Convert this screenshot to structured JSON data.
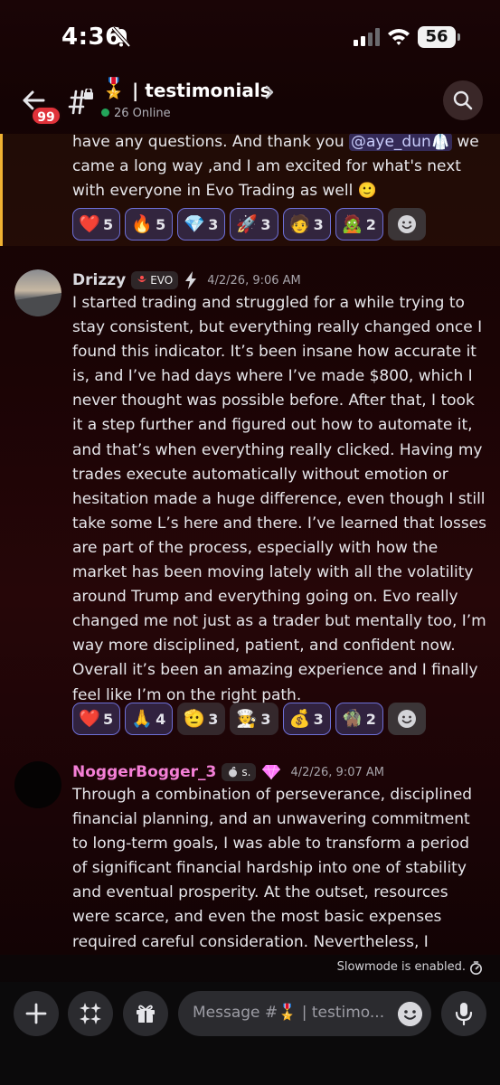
{
  "status_bar": {
    "time": "4:36",
    "battery": "56"
  },
  "header": {
    "back_badge": "99",
    "channel_emoji": "🎖️",
    "channel_name": "| testimonials",
    "online": "26 Online"
  },
  "messages": [
    {
      "text_before_mention": "have any questions. And thank you ",
      "mention": "@aye_dun🥼",
      "text_after_mention": " we came a long  way ,and I am excited for what's next with everyone in Evo Trading as well 🙂",
      "reactions": [
        {
          "emoji": "❤️",
          "count": "5"
        },
        {
          "emoji": "🔥",
          "count": "5"
        },
        {
          "emoji": "💎",
          "count": "3"
        },
        {
          "emoji": "🚀",
          "count": "3"
        },
        {
          "emoji": "🧑",
          "count": "3"
        },
        {
          "emoji": "🧟",
          "count": "2"
        }
      ]
    },
    {
      "author": "Drizzy",
      "author_color": "#d9d9de",
      "tag": "EVO",
      "timestamp": "4/2/26, 9:06 AM",
      "text": "I started trading and struggled for a while trying to stay consistent, but everything really changed once I found this indicator. It’s been insane how accurate it is, and I’ve had days where I’ve made $800, which I never thought was possible before. After that, I took it a step further and figured out how to automate it, and that’s when everything really clicked. Having my trades execute automatically without emotion or hesitation made a huge difference, even though I still take some L’s here and there. I’ve learned that losses are part of the process, especially with how the market has been moving lately with all the volatility around Trump and everything going on. Evo really changed me not just as a trader but mentally too, I’m way more disciplined, patient, and confident now. Overall it’s been an amazing experience and I finally feel like I’m on the right path.",
      "reactions": [
        {
          "emoji": "❤️",
          "count": "5"
        },
        {
          "emoji": "🙏",
          "count": "4"
        },
        {
          "emoji": "🫡",
          "count": "3"
        },
        {
          "emoji": "🧑‍🍳",
          "count": "3"
        },
        {
          "emoji": "💰",
          "count": "3"
        },
        {
          "emoji": "🧌",
          "count": "2"
        }
      ]
    },
    {
      "author": "NoggerBogger_3",
      "author_color": "#f47fd6",
      "tag": "s.",
      "timestamp": "4/2/26, 9:07 AM",
      "text": "Through a combination of perseverance, disciplined financial planning, and an unwavering commitment to long-term goals, I was able to transform a period of significant financial hardship into one of stability and eventual prosperity. At the outset, resources were scarce, and even the most basic expenses required careful consideration. Nevertheless, I adopted a mindset rooted in resilience, prioritizing budgeting"
    }
  ],
  "slowmode_text": "Slowmode is enabled.",
  "composer": {
    "placeholder": "Message #🎖️ | testimo..."
  }
}
